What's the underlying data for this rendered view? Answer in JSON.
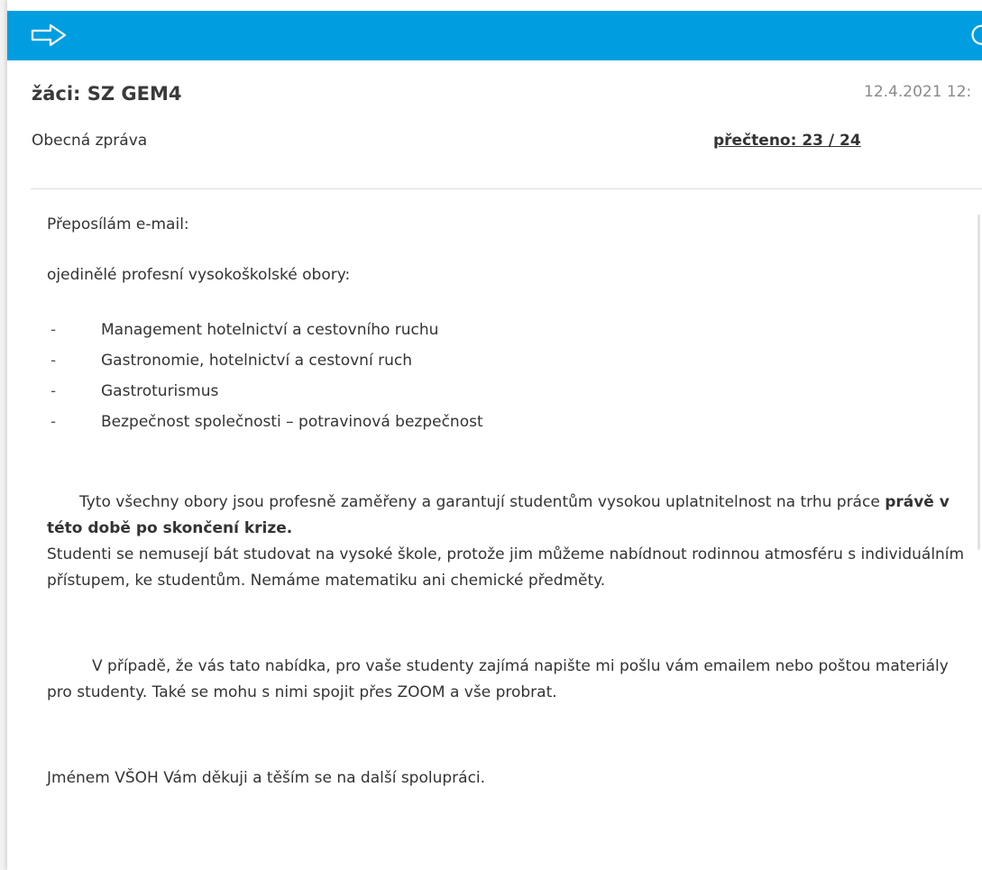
{
  "colors": {
    "topbar": "#009ee0",
    "divider": "#dcdcdc"
  },
  "toolbar": {
    "back_icon": "arrow-right-outline-icon",
    "refresh_icon": "refresh-icon"
  },
  "header": {
    "title": "žáci: SZ GEM4",
    "date": "12.4.2021 12:",
    "type": "Obecná zpráva",
    "read_count": "přečteno: 23 / 24"
  },
  "message": {
    "intro": "Přeposílám e-mail:",
    "lead": "ojedinělé profesní vysokoškolské obory:",
    "bullet": "-",
    "programs": [
      "Management hotelnictví a cestovního ruchu",
      "Gastronomie, hotelnictví a cestovní ruch",
      "Gastroturismus",
      "Bezpečnost společnosti – potravinová bezpečnost"
    ],
    "para1_text": "Tyto všechny obory jsou profesně zaměřeny a garantují studentům vysokou uplatnitelnost na trhu práce",
    "para1_bold": "právě v této době po skončení krize.",
    "para2": "Studenti se nemusejí bát studovat na vysoké škole, protože jim můžeme nabídnout rodinnou atmosféru s individuálním přístupem, ke studentům. Nemáme matematiku ani chemické předměty.",
    "para3": "V případě, že vás tato nabídka, pro vaše studenty zajímá napište mi pošlu vám emailem nebo poštou materiály pro studenty. Také se mohu s nimi spojit přes ZOOM a vše probrat.",
    "closing": "Jménem VŠOH Vám děkuji a těším se na další spolupráci."
  }
}
